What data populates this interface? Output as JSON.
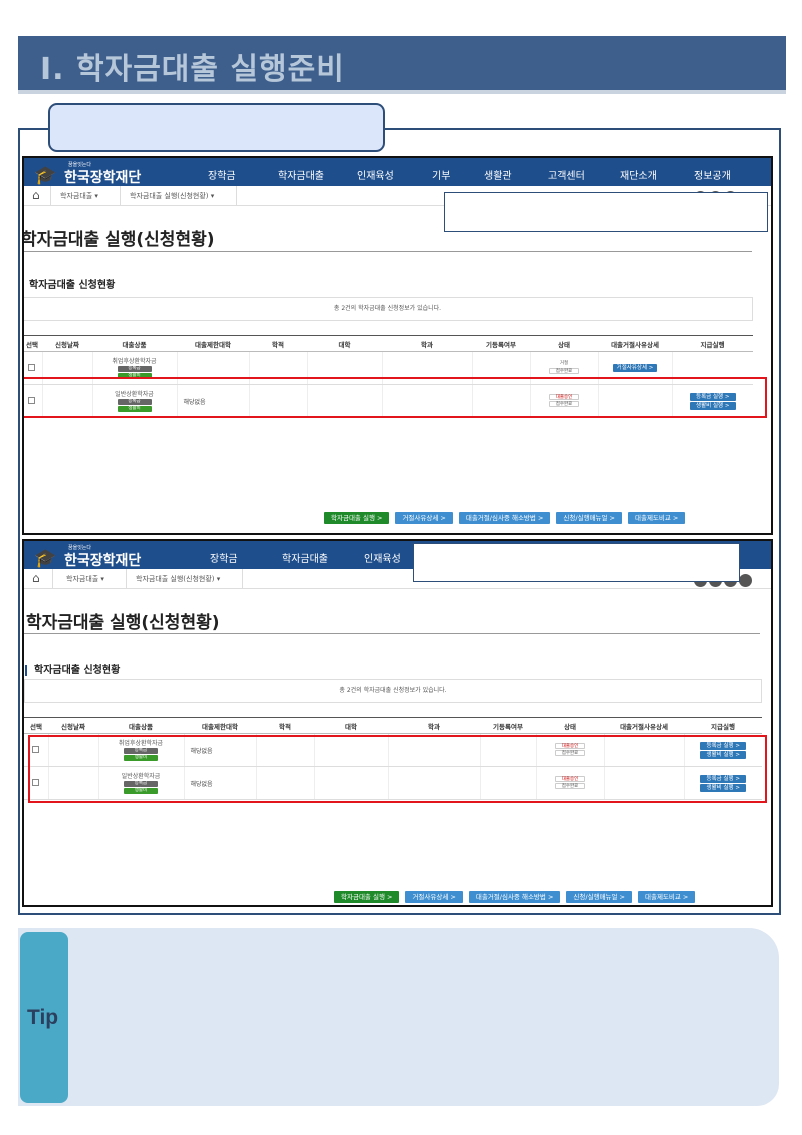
{
  "doc_title": "Ⅰ. 학자금대출 실행준비",
  "tip_label": "Tip",
  "screens": [
    {
      "logo_small": "꿈을잇는다",
      "logo_name": "한국장학재단",
      "nav": [
        "장학금",
        "학자금대출",
        "인재육성",
        "기부",
        "생활관",
        "고객센터",
        "재단소개",
        "정보공개"
      ],
      "breadcrumb": [
        "학자금대출",
        "학자금대출 실행(신청현황)"
      ],
      "page_title": "학자금대출 실행(신청현황)",
      "section_title": "학자금대출 신청현황",
      "info_text": "총 2건의 학자금대출 신청정보가 있습니다.",
      "columns": [
        "선택",
        "신청날짜",
        "대출상품",
        "대출제한대학",
        "학적",
        "대학",
        "학과",
        "기등록여부",
        "상태",
        "대출거절사유상세",
        "지급실행"
      ],
      "rows": [
        {
          "product": "취업후상환학자금",
          "tags": [
            "등록금",
            "생활비"
          ],
          "univ_limit": "",
          "status": [
            "거절",
            "접수완료"
          ],
          "reject_btn": "거절사유상세 >",
          "pay_btns": []
        },
        {
          "product": "일반상환학자금",
          "tags": [
            "등록금",
            "생활비"
          ],
          "univ_limit": "해당없음",
          "status": [
            "대출승인",
            "접수완료"
          ],
          "reject_btn": "",
          "pay_btns": [
            "등록금 실행 >",
            "생활비 실행 >"
          ]
        }
      ],
      "bottom_buttons": [
        "학자금대출 실행 >",
        "거절사유상세 >",
        "대출거절/심사중 해소방법 >",
        "신청/실행매뉴얼 >",
        "대출제도비교 >"
      ]
    },
    {
      "logo_small": "꿈을잇는다",
      "logo_name": "한국장학재단",
      "nav": [
        "장학금",
        "학자금대출",
        "인재육성"
      ],
      "breadcrumb": [
        "학자금대출",
        "학자금대출 실행(신청현황)"
      ],
      "page_title": "학자금대출 실행(신청현황)",
      "section_title": "학자금대출 신청현황",
      "info_text": "총 2건의 학자금대출 신청정보가 있습니다.",
      "columns": [
        "선택",
        "신청날짜",
        "대출상품",
        "대출제한대학",
        "학적",
        "대학",
        "학과",
        "기등록여부",
        "상태",
        "대출거절사유상세",
        "지급실행"
      ],
      "rows": [
        {
          "product": "취업후상환학자금",
          "tags": [
            "등록금",
            "생활비"
          ],
          "univ_limit": "해당없음",
          "status": [
            "대출승인",
            "접수완료"
          ],
          "reject_btn": "",
          "pay_btns": [
            "등록금 실행 >",
            "생활비 실행 >"
          ]
        },
        {
          "product": "일반상환학자금",
          "tags": [
            "등록금",
            "생활비"
          ],
          "univ_limit": "해당없음",
          "status": [
            "대출승인",
            "접수완료"
          ],
          "reject_btn": "",
          "pay_btns": [
            "등록금 실행 >",
            "생활비 실행 >"
          ]
        }
      ],
      "bottom_buttons": [
        "학자금대출 실행 >",
        "거절사유상세 >",
        "대출거절/심사중 해소방법 >",
        "신청/실행매뉴얼 >",
        "대출제도비교 >"
      ]
    }
  ],
  "colors": {
    "title_bar": "#3e5f8c",
    "nav": "#1f4e8c",
    "highlight": "#e2141c",
    "tip_strip": "#4aa9c6",
    "tip_panel": "#dde6f3"
  }
}
